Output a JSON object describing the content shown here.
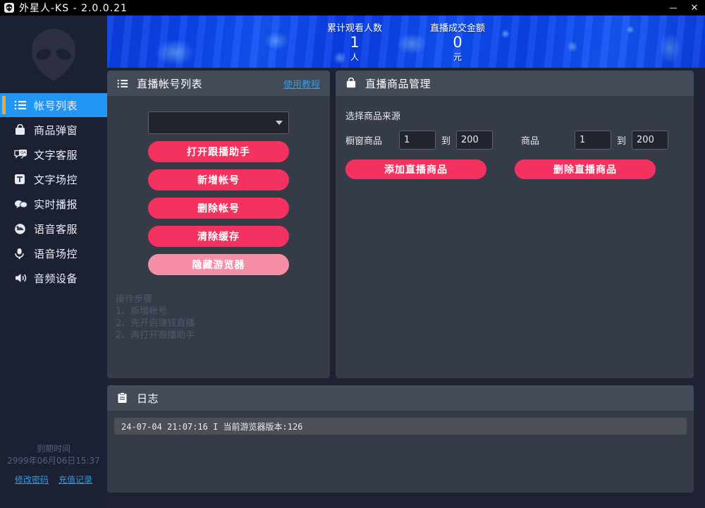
{
  "window": {
    "title": "外星人-KS - 2.0.0.21",
    "app_icon": "alien-icon",
    "minimize_label": "",
    "close_label": "✕"
  },
  "sidebar": {
    "logo": "alien-logo",
    "items": [
      {
        "label": "帐号列表",
        "icon": "list-icon",
        "active": true
      },
      {
        "label": "商品弹窗",
        "icon": "bag-icon",
        "active": false
      },
      {
        "label": "文字客服",
        "icon": "chat-qa-icon",
        "active": false
      },
      {
        "label": "文字场控",
        "icon": "text-box-icon",
        "active": false
      },
      {
        "label": "实时播报",
        "icon": "speech-bubbles-icon",
        "active": false
      },
      {
        "label": "语音客服",
        "icon": "headset-icon",
        "active": false
      },
      {
        "label": "语音场控",
        "icon": "microphone-icon",
        "active": false
      },
      {
        "label": "音频设备",
        "icon": "speaker-icon",
        "active": false
      }
    ],
    "expiry_label": "到期时间",
    "expiry_value": "2999年06月06日15:37",
    "links": [
      {
        "label": "修改密码"
      },
      {
        "label": "充值记录"
      }
    ]
  },
  "banner": {
    "stats": [
      {
        "label": "累计观看人数",
        "value": "1",
        "unit": "人"
      },
      {
        "label": "直播成交金额",
        "value": "0",
        "unit": "元"
      }
    ]
  },
  "accounts_panel": {
    "icon": "list-icon",
    "title": "直播帐号列表",
    "help_link": "使用教程",
    "select_value": "",
    "buttons": [
      {
        "label": "打开跟播助手",
        "style": "primary"
      },
      {
        "label": "新增帐号",
        "style": "primary"
      },
      {
        "label": "删除帐号",
        "style": "primary"
      },
      {
        "label": "清除缓存",
        "style": "primary"
      },
      {
        "label": "隐藏游览器",
        "style": "light"
      }
    ],
    "steps": [
      "操作步骤",
      "1、新增帐号",
      "2、先开启赚钱直播",
      "2、再打开跟播助手"
    ]
  },
  "goods_panel": {
    "icon": "bag-icon",
    "title": "直播商品管理",
    "source_label": "选择商品来源",
    "ranges": [
      {
        "label": "橱窗商品",
        "from": "1",
        "to_label": "到",
        "to": "200"
      },
      {
        "label": "商品",
        "from": "1",
        "to_label": "到",
        "to": "200"
      }
    ],
    "buttons": [
      {
        "label": "添加直播商品"
      },
      {
        "label": "删除直播商品"
      }
    ]
  },
  "log_panel": {
    "icon": "clipboard-icon",
    "title": "日志",
    "entries": [
      "24-07-04 21:07:16  I    当前游览器版本:126"
    ]
  },
  "colors": {
    "accent_pink": "#f4325f",
    "accent_pink_light": "#f48fa7",
    "active_blue": "#2196f3",
    "link_blue": "#2f9bea",
    "orange_marker": "#f5a623",
    "sidebar_bg": "#1b2033",
    "panel_bg": "#353b47",
    "panel_head_bg": "#434a58"
  }
}
